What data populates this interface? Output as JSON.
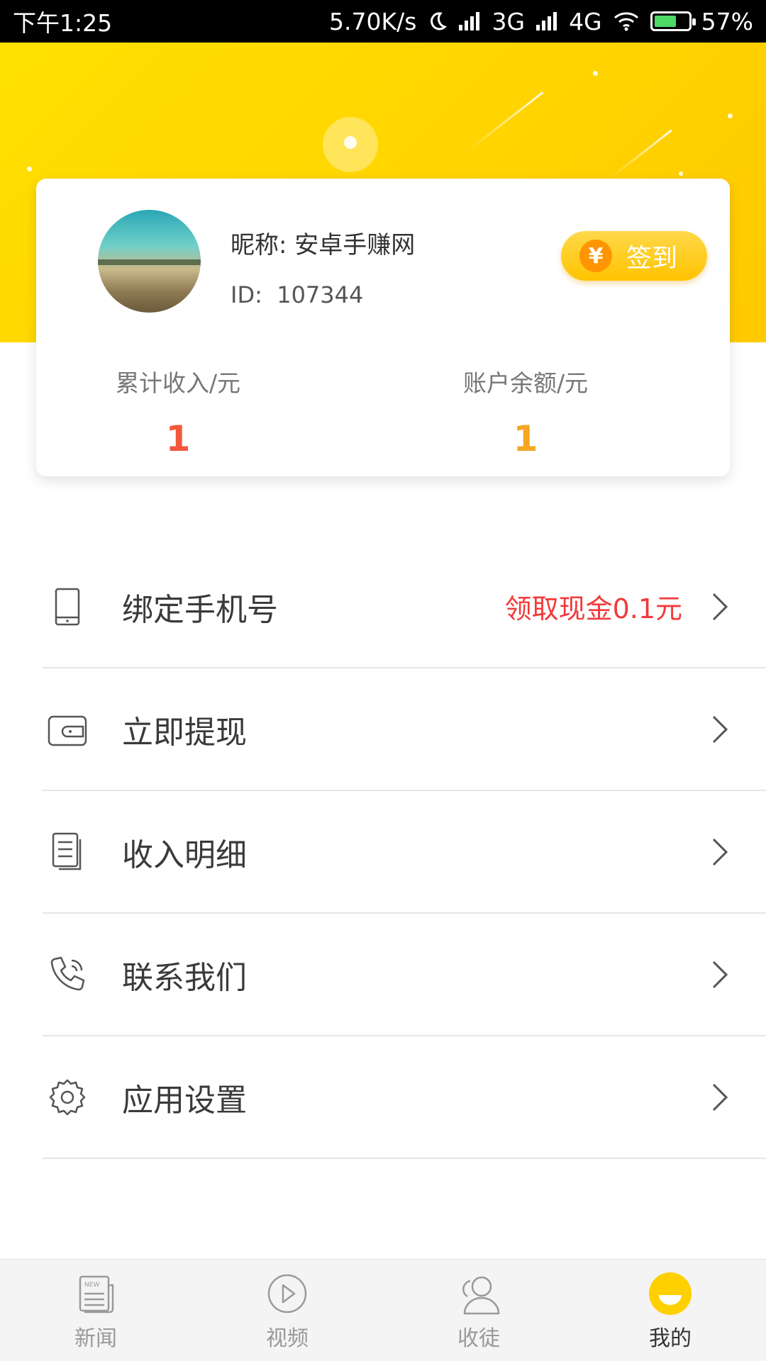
{
  "status_bar": {
    "time": "下午1:25",
    "speed": "5.70K/s",
    "network1": "3G",
    "network2": "4G",
    "battery": "57%"
  },
  "profile": {
    "nickname": "昵称: 安卓手赚网",
    "id_label": "ID:",
    "id_value": "107344",
    "checkin_label": "签到",
    "coin_symbol": "¥"
  },
  "stats": {
    "total_income_label": "累计收入/元",
    "total_income_value": "1",
    "balance_label": "账户余额/元",
    "balance_value": "1"
  },
  "menu": {
    "items": [
      {
        "label": "绑定手机号",
        "extra": "领取现金0.1元",
        "icon": "phone-icon"
      },
      {
        "label": "立即提现",
        "extra": "",
        "icon": "wallet-icon"
      },
      {
        "label": "收入明细",
        "extra": "",
        "icon": "document-icon"
      },
      {
        "label": "联系我们",
        "extra": "",
        "icon": "telephone-icon"
      },
      {
        "label": "应用设置",
        "extra": "",
        "icon": "gear-icon"
      }
    ]
  },
  "bottom_nav": {
    "items": [
      {
        "label": "新闻",
        "icon": "news-icon"
      },
      {
        "label": "视频",
        "icon": "play-icon"
      },
      {
        "label": "收徒",
        "icon": "users-icon"
      },
      {
        "label": "我的",
        "icon": "profile-icon",
        "active": true
      }
    ]
  },
  "colors": {
    "header_yellow": "#ffd600",
    "income_red": "#f2593b",
    "balance_orange": "#f5a623",
    "extra_red": "#f23a3a",
    "checkin_orange": "#ff9500"
  }
}
